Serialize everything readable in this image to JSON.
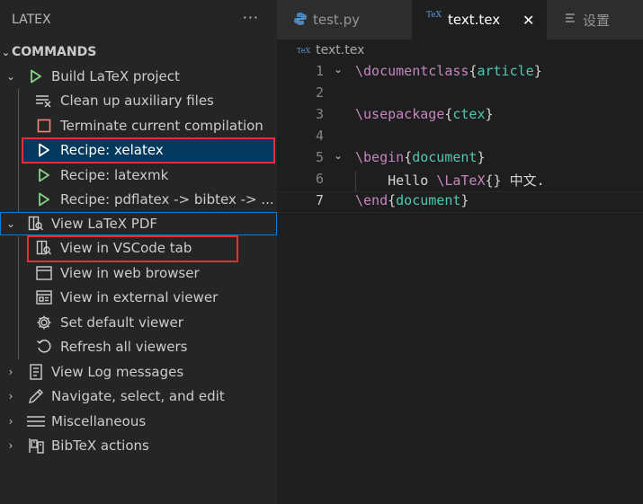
{
  "sidebar": {
    "title": "LATEX",
    "more": "···",
    "section": "COMMANDS",
    "items": [
      {
        "label": "Build LaTeX project",
        "icon": "play-icon"
      },
      {
        "label": "Clean up auxiliary files",
        "icon": "clear-all-icon"
      },
      {
        "label": "Terminate current compilation",
        "icon": "stop-icon"
      },
      {
        "label": "Recipe: xelatex",
        "icon": "play-icon"
      },
      {
        "label": "Recipe: latexmk",
        "icon": "play-icon"
      },
      {
        "label": "Recipe: pdflatex -> bibtex -> ...",
        "icon": "play-icon"
      },
      {
        "label": "View LaTeX PDF",
        "icon": "open-preview-icon"
      },
      {
        "label": "View in VSCode tab",
        "icon": "open-preview-icon"
      },
      {
        "label": "View in web browser",
        "icon": "browser-icon"
      },
      {
        "label": "View in external viewer",
        "icon": "window-icon"
      },
      {
        "label": "Set default viewer",
        "icon": "gear-icon"
      },
      {
        "label": "Refresh all viewers",
        "icon": "refresh-icon"
      },
      {
        "label": "View Log messages",
        "icon": "log-icon"
      },
      {
        "label": "Navigate, select, and edit",
        "icon": "pen-icon"
      },
      {
        "label": "Miscellaneous",
        "icon": "menu-icon"
      },
      {
        "label": "BibTeX actions",
        "icon": "bibtex-icon"
      }
    ]
  },
  "tabs": [
    {
      "label": "test.py",
      "icon": "python-icon"
    },
    {
      "label": "text.tex",
      "icon": "tex-icon",
      "close": "✕"
    },
    {
      "label": "设置",
      "icon": "settings-icon"
    }
  ],
  "tex_badge": "TeX",
  "breadcrumb": "text.tex",
  "editor": {
    "lines": [
      {
        "num": "1",
        "cmd": "\\documentclass",
        "open": "{",
        "arg": "article",
        "close": "}"
      },
      {
        "num": "2"
      },
      {
        "num": "3",
        "cmd": "\\usepackage",
        "open": "{",
        "arg": "ctex",
        "close": "}"
      },
      {
        "num": "4"
      },
      {
        "num": "5",
        "cmd": "\\begin",
        "open": "{",
        "arg": "document",
        "close": "}"
      },
      {
        "num": "6",
        "indent": "    ",
        "pre": "Hello ",
        "cmd": "\\LaTeX",
        "post": "{} 中文."
      },
      {
        "num": "7",
        "cmd": "\\end",
        "open": "{",
        "arg": "document",
        "close": "}"
      }
    ]
  },
  "colors": {
    "accent": "#007fd4",
    "selected": "#04395e",
    "highlight_box": "#e0303a",
    "play_green": "#89d185",
    "stop_red": "#f48771",
    "keyword": "#c586c0",
    "argument": "#4ec9b0"
  }
}
